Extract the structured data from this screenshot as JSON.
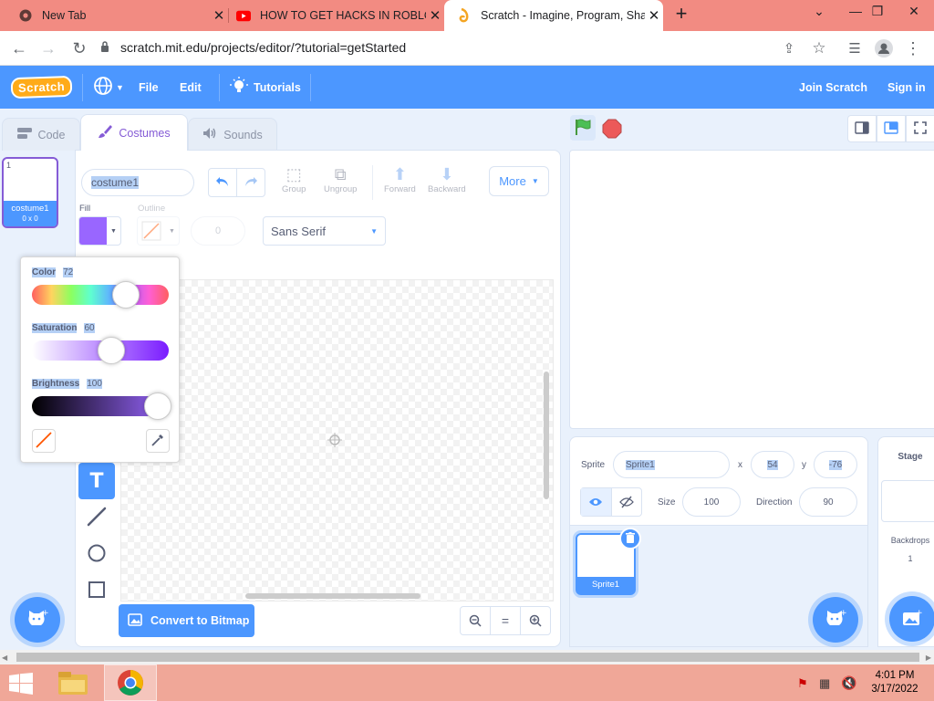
{
  "browser": {
    "tabs": [
      {
        "title": "New Tab"
      },
      {
        "title": "HOW TO GET HACKS IN ROBLOX"
      },
      {
        "title": "Scratch - Imagine, Program, Share"
      }
    ],
    "url": "scratch.mit.edu/projects/editor/?tutorial=getStarted"
  },
  "menubar": {
    "logo": "Scratch",
    "file": "File",
    "edit": "Edit",
    "tutorials": "Tutorials",
    "join": "Join Scratch",
    "signin": "Sign in"
  },
  "editor_tabs": {
    "code": "Code",
    "costumes": "Costumes",
    "sounds": "Sounds"
  },
  "costume_list": [
    {
      "index": "1",
      "name": "costume1",
      "size": "0 x 0"
    }
  ],
  "paint": {
    "costume_name": "costume1",
    "group": "Group",
    "ungroup": "Ungroup",
    "forward": "Forward",
    "backward": "Backward",
    "more": "More",
    "fill_label": "Fill",
    "outline_label": "Outline",
    "outline_width": "0",
    "font": "Sans Serif",
    "convert": "Convert to Bitmap",
    "fill_color": "#9966ff"
  },
  "color_picker": {
    "color_label": "Color",
    "color_value": "72",
    "saturation_label": "Saturation",
    "saturation_value": "60",
    "brightness_label": "Brightness",
    "brightness_value": "100"
  },
  "sprite_info": {
    "sprite_label": "Sprite",
    "sprite_name": "Sprite1",
    "x_label": "x",
    "x_value": "54",
    "y_label": "y",
    "y_value": "-76",
    "size_label": "Size",
    "size_value": "100",
    "direction_label": "Direction",
    "direction_value": "90"
  },
  "sprites": [
    {
      "name": "Sprite1"
    }
  ],
  "stage_panel": {
    "title": "Stage",
    "backdrops_label": "Backdrops",
    "backdrops_count": "1"
  },
  "taskbar": {
    "time": "4:01 PM",
    "date": "3/17/2022"
  }
}
